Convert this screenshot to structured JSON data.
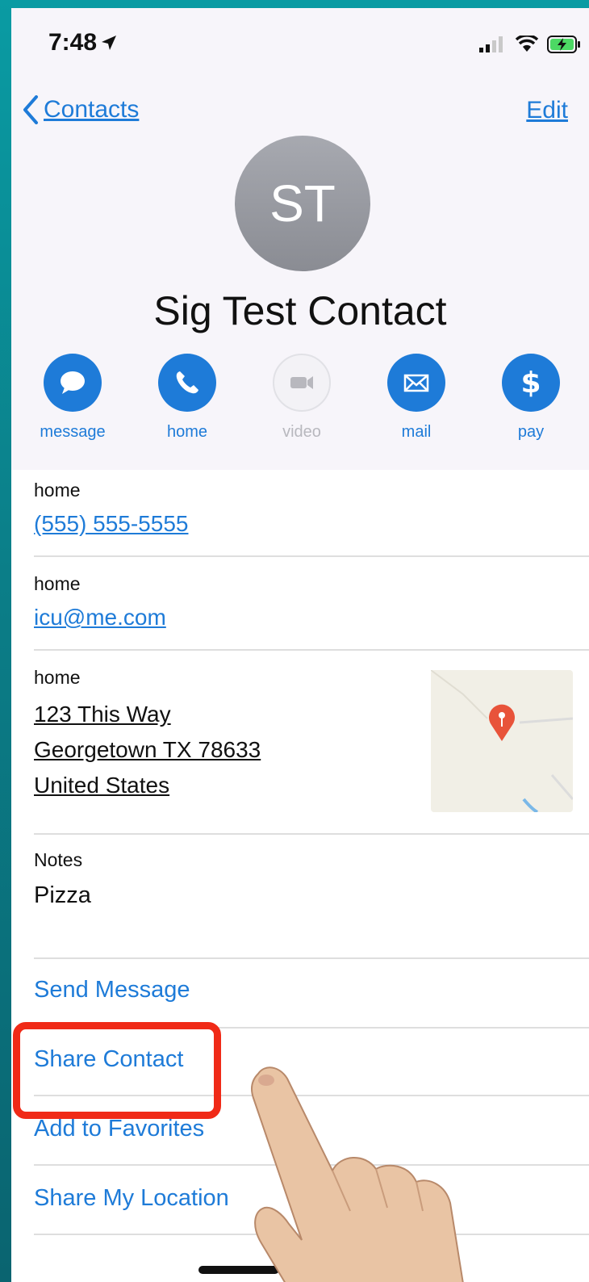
{
  "status": {
    "time": "7:48"
  },
  "nav": {
    "back_label": "Contacts",
    "edit_label": "Edit"
  },
  "contact": {
    "initials": "ST",
    "name": "Sig Test Contact"
  },
  "actions": [
    {
      "label": "message",
      "icon": "message-bubble-icon",
      "enabled": true
    },
    {
      "label": "home",
      "icon": "phone-icon",
      "enabled": true
    },
    {
      "label": "video",
      "icon": "video-camera-icon",
      "enabled": false
    },
    {
      "label": "mail",
      "icon": "envelope-icon",
      "enabled": true
    },
    {
      "label": "pay",
      "icon": "dollar-icon",
      "enabled": true
    }
  ],
  "phone": {
    "label": "home",
    "value": "(555) 555-5555"
  },
  "email": {
    "label": "home",
    "value": "icu@me.com"
  },
  "address": {
    "label": "home",
    "line1": "123 This Way",
    "line2": "Georgetown  TX 78633",
    "line3": "United States"
  },
  "notes": {
    "label": "Notes",
    "value": "Pizza"
  },
  "links": {
    "send_message": "Send Message",
    "share_contact": "Share Contact",
    "add_favorites": "Add to Favorites",
    "share_location": "Share My Location"
  },
  "colors": {
    "accent": "#1e7bd8",
    "highlight": "#f02a17",
    "background": "#0a9ba3"
  }
}
